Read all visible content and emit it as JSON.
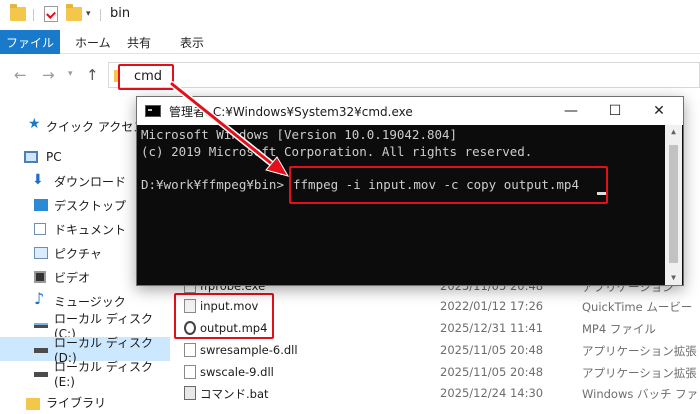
{
  "window": {
    "title": "bin"
  },
  "ribbon": {
    "tabs": [
      "ファイル",
      "ホーム",
      "共有",
      "表示"
    ]
  },
  "address": {
    "value": "cmd"
  },
  "sidebar": {
    "items": [
      {
        "label": "クイック アクセス",
        "icon": "star-icon"
      },
      {
        "label": "PC",
        "icon": "pc-icon"
      },
      {
        "label": "ダウンロード",
        "icon": "download-icon"
      },
      {
        "label": "デスクトップ",
        "icon": "desktop-icon"
      },
      {
        "label": "ドキュメント",
        "icon": "document-icon"
      },
      {
        "label": "ピクチャ",
        "icon": "picture-icon"
      },
      {
        "label": "ビデオ",
        "icon": "video-icon"
      },
      {
        "label": "ミュージック",
        "icon": "music-icon"
      },
      {
        "label": "ローカル ディスク (C:)",
        "icon": "drive-icon"
      },
      {
        "label": "ローカル ディスク (D:)",
        "icon": "drive-icon"
      },
      {
        "label": "ローカル ディスク (E:)",
        "icon": "drive-icon"
      },
      {
        "label": "ライブラリ",
        "icon": "library-icon"
      }
    ]
  },
  "files": [
    {
      "name": "ffprobe.exe",
      "date": "2025/11/05 20:48",
      "type": "アプリケーション"
    },
    {
      "name": "input.mov",
      "date": "2022/01/12 17:26",
      "type": "QuickTime ムービー"
    },
    {
      "name": "output.mp4",
      "date": "2025/12/31 11:41",
      "type": "MP4 ファイル"
    },
    {
      "name": "swresample-6.dll",
      "date": "2025/11/05 20:48",
      "type": "アプリケーション拡張"
    },
    {
      "name": "swscale-9.dll",
      "date": "2025/11/05 20:48",
      "type": "アプリケーション拡張"
    },
    {
      "name": "コマンド.bat",
      "date": "2025/12/24 14:30",
      "type": "Windows バッチ ファ"
    }
  ],
  "cmd": {
    "title": "管理者: C:¥Windows¥System32¥cmd.exe",
    "lines": [
      "Microsoft Windows [Version 10.0.19042.804]",
      "(c) 2019 Microsoft Corporation. All rights reserved.",
      "",
      "D:¥work¥ffmpeg¥bin>"
    ],
    "command": "ffmpeg -i input.mov -c copy output.mp4",
    "minimize": "—",
    "maximize": "☐",
    "close": "✕"
  },
  "colors": {
    "accent": "#1979ca",
    "highlight": "#e3101b",
    "console_bg": "#0c0c0c",
    "console_fg": "#cccccc"
  }
}
